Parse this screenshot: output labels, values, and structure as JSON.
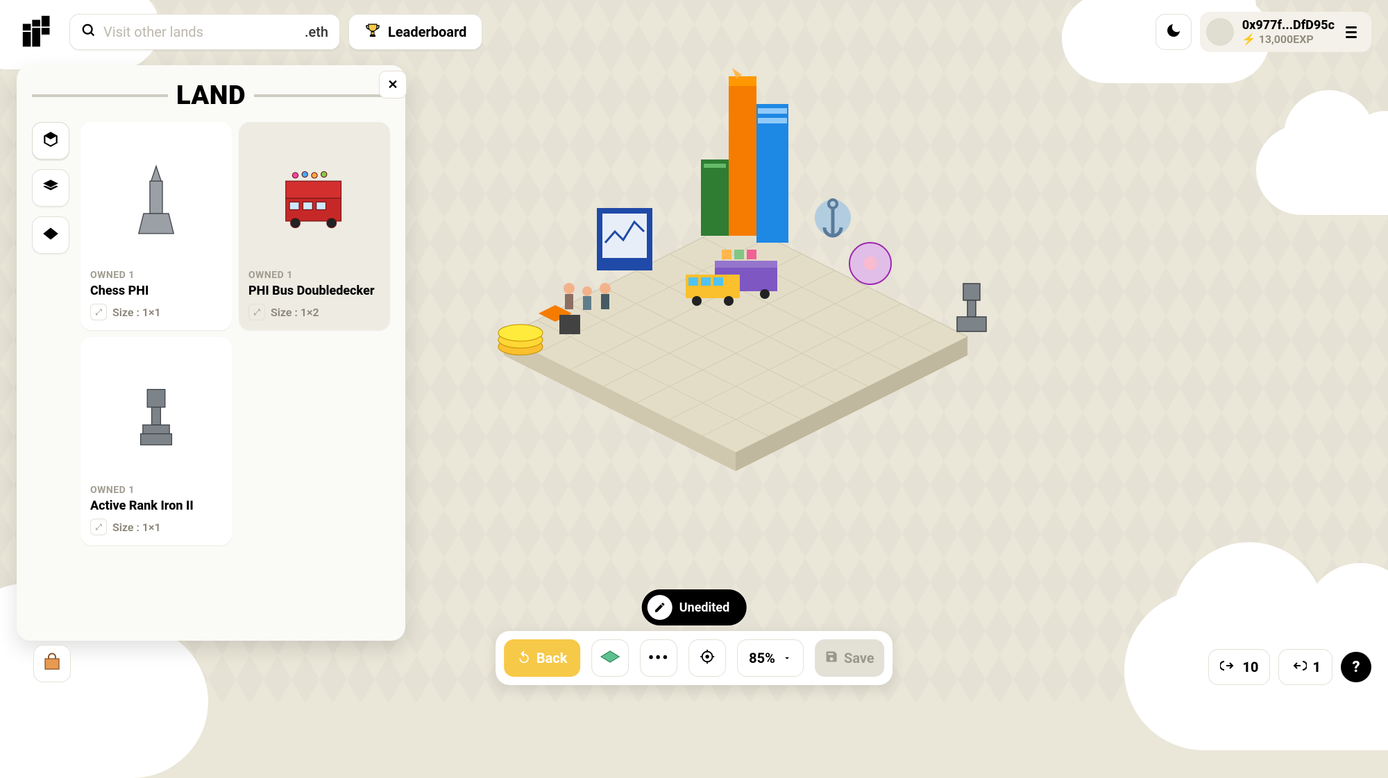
{
  "header": {
    "search_placeholder": "Visit other lands",
    "search_suffix": ".eth",
    "leaderboard_label": "Leaderboard",
    "account_address": "0x977f...DfD95c",
    "exp_label": "13,000EXP"
  },
  "land_panel": {
    "title": "LAND",
    "tabs": {
      "cube": "objects",
      "layers": "layers",
      "diamond": "ground"
    },
    "items": [
      {
        "owned_label": "OWNED 1",
        "name": "Chess PHI",
        "size_label": "Size : 1×1",
        "selected": false
      },
      {
        "owned_label": "OWNED 1",
        "name": "PHI Bus Doubledecker",
        "size_label": "Size : 1×2",
        "selected": true
      },
      {
        "owned_label": "OWNED 1",
        "name": "Active Rank Iron II",
        "size_label": "Size : 1×1",
        "selected": false
      }
    ]
  },
  "status_pill": {
    "label": "Unedited"
  },
  "toolbar": {
    "back_label": "Back",
    "zoom_label": "85%",
    "save_label": "Save"
  },
  "bottom_right": {
    "link_in_count": "10",
    "link_out_count": "1"
  },
  "iso_objects": [
    "orange-tower",
    "blue-tower",
    "green-tower",
    "screen-kiosk",
    "food-truck",
    "yellow-bus",
    "coins-stack",
    "ship-anchor",
    "pink-disc",
    "chess-piece-right",
    "group-of-people"
  ],
  "colors": {
    "bg": "#EAE6D8",
    "accent": "#F7C948",
    "panel": "#fafaf7"
  }
}
